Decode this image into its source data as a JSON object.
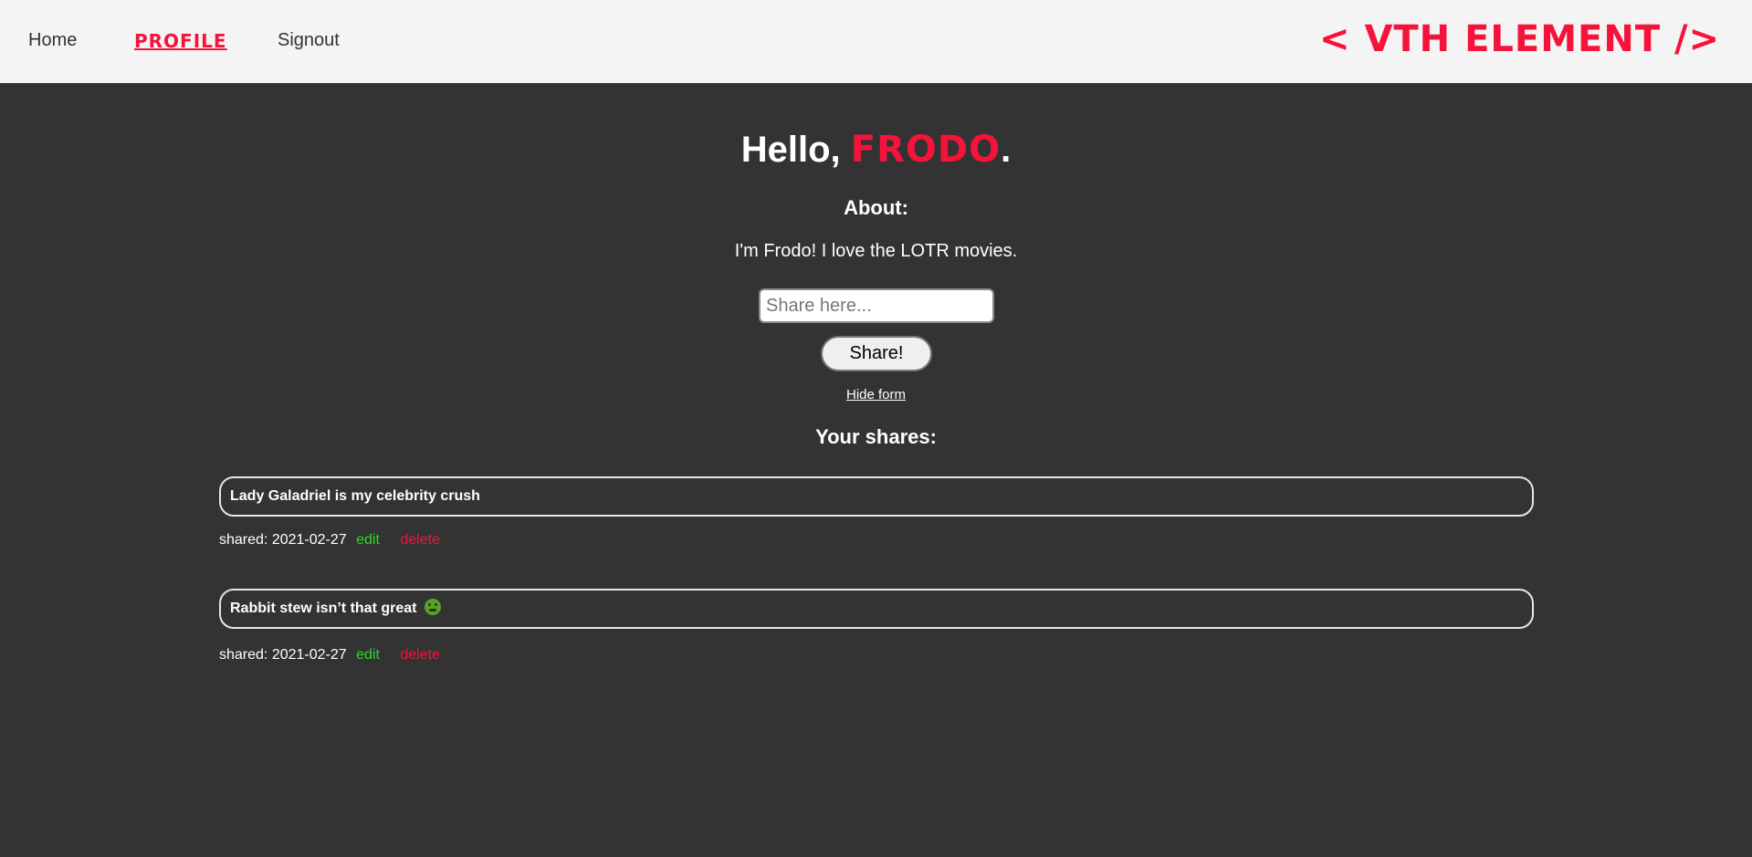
{
  "nav": {
    "home": "Home",
    "profile": "PROFILE",
    "signout": "Signout",
    "logo": "< VTH ELEMENT />"
  },
  "profile": {
    "greeting_prefix": "Hello, ",
    "username": "FRODO",
    "greeting_suffix": ".",
    "about_heading": "About:",
    "about_text": "I'm Frodo! I love the LOTR movies."
  },
  "form": {
    "placeholder": "Share here...",
    "button": "Share!",
    "hide_link": "Hide form"
  },
  "shares": {
    "heading": "Your shares:",
    "items": [
      {
        "text": "Lady Galadriel is my celebrity crush",
        "shared_label": "shared: 2021-02-27",
        "edit": "edit",
        "delete": "delete",
        "icon": null
      },
      {
        "text": "Rabbit stew isn’t that great",
        "shared_label": "shared: 2021-02-27",
        "edit": "edit",
        "delete": "delete",
        "icon": "nauseated-face-icon"
      }
    ]
  },
  "colors": {
    "accent": "#f5133b",
    "background": "#333333",
    "navbar": "#f4f4f4",
    "edit": "#22dd22"
  }
}
